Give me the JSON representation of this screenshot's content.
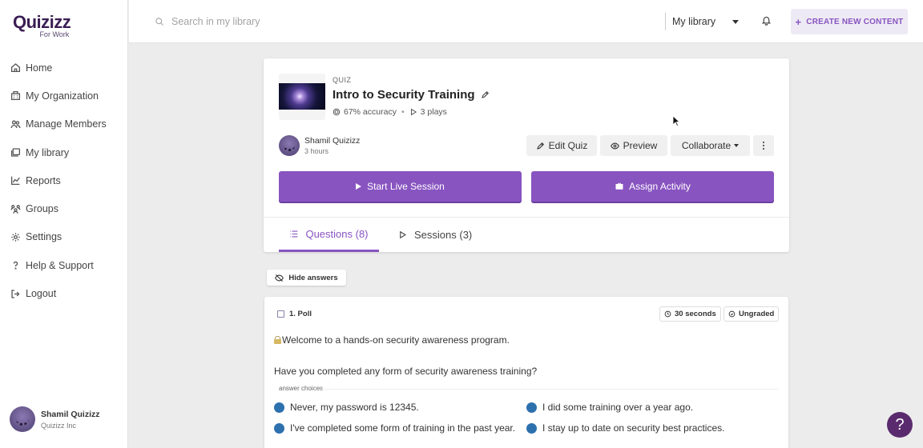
{
  "brand": {
    "name": "Quizizz",
    "sub": "For Work",
    "color": "#3b1e54"
  },
  "colors": {
    "accent": "#8854c0",
    "bullet": "#2d70ae",
    "help": "#5a2a6e"
  },
  "sidebar": {
    "items": [
      {
        "label": "Home",
        "icon": "home-icon"
      },
      {
        "label": "My Organization",
        "icon": "building-icon"
      },
      {
        "label": "Manage Members",
        "icon": "users-icon"
      },
      {
        "label": "My library",
        "icon": "folder-icon"
      },
      {
        "label": "Reports",
        "icon": "chart-icon"
      },
      {
        "label": "Groups",
        "icon": "groups-icon"
      },
      {
        "label": "Settings",
        "icon": "gear-icon"
      },
      {
        "label": "Help & Support",
        "icon": "question-icon"
      },
      {
        "label": "Logout",
        "icon": "logout-icon"
      }
    ],
    "user": {
      "name": "Shamil Quizizz",
      "org": "Quizizz Inc"
    }
  },
  "topbar": {
    "search_placeholder": "Search in my library",
    "library_select": "My library",
    "create_label": "CREATE NEW CONTENT"
  },
  "quiz": {
    "tag": "QUIZ",
    "title": "Intro to Security Training",
    "accuracy": "67% accuracy",
    "plays": "3 plays",
    "author": "Shamil Quizizz",
    "time": "3 hours",
    "edit_label": "Edit Quiz",
    "preview_label": "Preview",
    "collaborate_label": "Collaborate",
    "start_label": "Start Live Session",
    "assign_label": "Assign Activity"
  },
  "tabs": {
    "questions": "Questions (8)",
    "sessions": "Sessions (3)"
  },
  "hide_answers_label": "Hide answers",
  "question": {
    "header": "1. Poll",
    "time_badge": "30 seconds",
    "grade_badge": "Ungraded",
    "text1": "Welcome to a hands-on security awareness program.",
    "text2": "Have you completed any form of security awareness training?",
    "choices_label": "answer choices",
    "choices": [
      "Never, my password is 12345.",
      "I did some training over a year ago.",
      "I've completed some form of training in the past year.",
      "I stay up to date on security best practices."
    ]
  },
  "help_label": "?"
}
